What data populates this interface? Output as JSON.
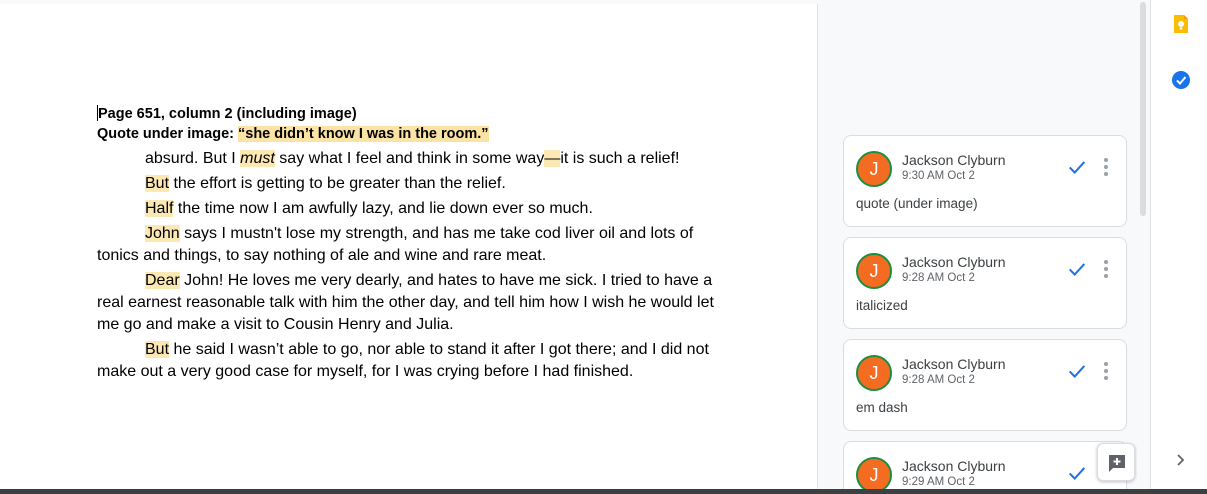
{
  "document": {
    "head1": "Page 651, column 2 (including image)",
    "head2_label": "Quote under image: ",
    "head2_quote": "“she didn’t know I was in the room.”",
    "p1_a": "absurd. But I ",
    "p1_must": "must",
    "p1_b": " say what I feel and think in some way",
    "p1_dash": "—",
    "p1_c": "it is such a relief!",
    "p2_hl": "But",
    "p2_rest": " the effort is getting to be greater than the relief.",
    "p3_hl": "Half",
    "p3_rest": " the time now I am awfully lazy, and lie down ever so much.",
    "p4_hl": "John",
    "p4_rest1": " says I mustn't lose my strength, and has me take cod liver oil and lots of",
    "p4_rest2": "tonics and things, to say nothing of ale and wine and rare meat.",
    "p5_hl": "Dear",
    "p5_rest1": " John! He loves me very dearly, and hates to have me sick. I tried to have a",
    "p5_rest2": "real earnest reasonable talk with him the other day, and tell him how I wish he would let",
    "p5_rest3": "me go and make a visit to Cousin Henry and Julia.",
    "p6_hl": "But",
    "p6_rest1": " he said I wasn’t able to go, nor able to stand it after I got there; and I did not",
    "p6_rest2": "make out a very good case for myself, for I was crying before I had finished."
  },
  "comments": [
    {
      "initial": "J",
      "author": "Jackson Clyburn",
      "time": "9:30 AM Oct 2",
      "text": "quote (under image)"
    },
    {
      "initial": "J",
      "author": "Jackson Clyburn",
      "time": "9:28 AM Oct 2",
      "text": "italicized"
    },
    {
      "initial": "J",
      "author": "Jackson Clyburn",
      "time": "9:28 AM Oct 2",
      "text": "em dash"
    },
    {
      "initial": "J",
      "author": "Jackson Clyburn",
      "time": "9:29 AM Oct 2",
      "text": ""
    }
  ],
  "icons": {
    "rail_top": "keep-notes-icon",
    "rail_second": "tasks-icon",
    "rail_bottom": "chevron-right-icon",
    "floating": "add-comment-icon",
    "resolve": "checkmark-icon",
    "more": "more-vert-icon"
  },
  "colors": {
    "highlight": "#fce8b2",
    "avatar": "#f36c21",
    "avatar_ring": "#1e8e3e",
    "check": "#1a73e8",
    "keep": "#fbbc04"
  }
}
